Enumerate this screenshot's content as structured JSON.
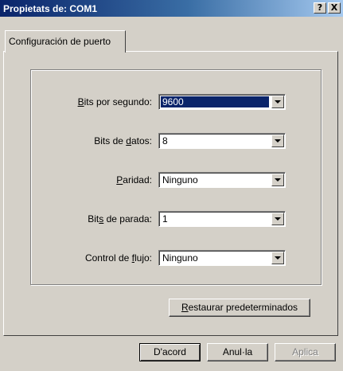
{
  "window": {
    "title": "Propietats de: COM1",
    "help_glyph": "?",
    "close_glyph": "X"
  },
  "tab": {
    "label": "Configuración de puerto"
  },
  "fields": [
    {
      "label_u": "B",
      "label_rest": "its por segundo:",
      "value": "9600"
    },
    {
      "label_pre": "Bits de ",
      "label_u": "d",
      "label_rest": "atos:",
      "value": "8"
    },
    {
      "label_u": "P",
      "label_rest": "aridad:",
      "value": "Ninguno"
    },
    {
      "label_pre": "Bit",
      "label_u": "s",
      "label_rest": " de parada:",
      "value": "1"
    },
    {
      "label_pre": "Control de ",
      "label_u": "f",
      "label_rest": "lujo:",
      "value": "Ninguno"
    }
  ],
  "restore_button": {
    "label_u": "R",
    "label_rest": "estaurar predeterminados"
  },
  "footer": {
    "ok_label": "D'acord",
    "cancel_label": "Anul·la",
    "apply_label": "Aplica"
  }
}
